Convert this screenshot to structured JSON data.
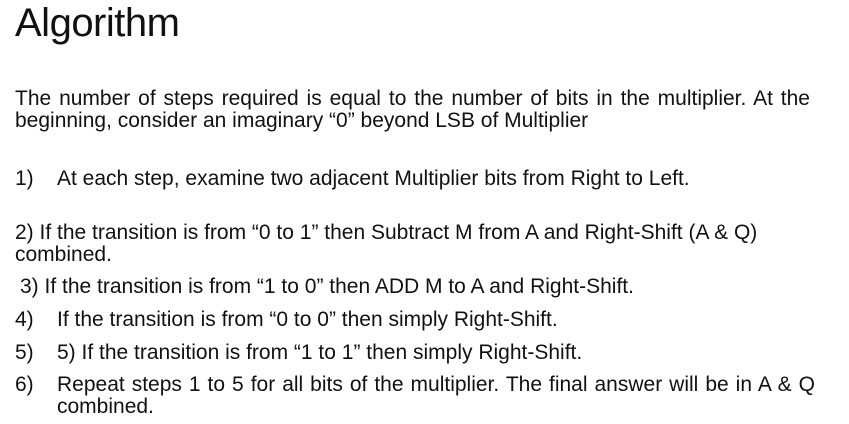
{
  "title": "Algorithm",
  "intro": "The number of steps required is equal to the number of bits in the multiplier. At the beginning, consider an imaginary “0” beyond LSB of Multiplier",
  "steps": [
    {
      "num": "1)",
      "text": "At each step, examine two adjacent Multiplier bits from Right to Left."
    },
    {
      "num": "",
      "text": "2) If the transition is from “0 to 1” then Subtract M from A and Right-Shift (A & Q) combined."
    },
    {
      "num": "",
      "text": "3) If the transition is from “1 to 0” then ADD M to A and Right-Shift."
    },
    {
      "num": "4)",
      "text": "If the transition is from “0 to 0” then simply Right-Shift."
    },
    {
      "num": "5)",
      "text": "5) If the transition is from “1 to 1” then simply Right-Shift."
    },
    {
      "num": "6)",
      "text": "Repeat steps 1 to 5 for all bits of the multiplier. The final answer will be in A & Q combined."
    }
  ]
}
